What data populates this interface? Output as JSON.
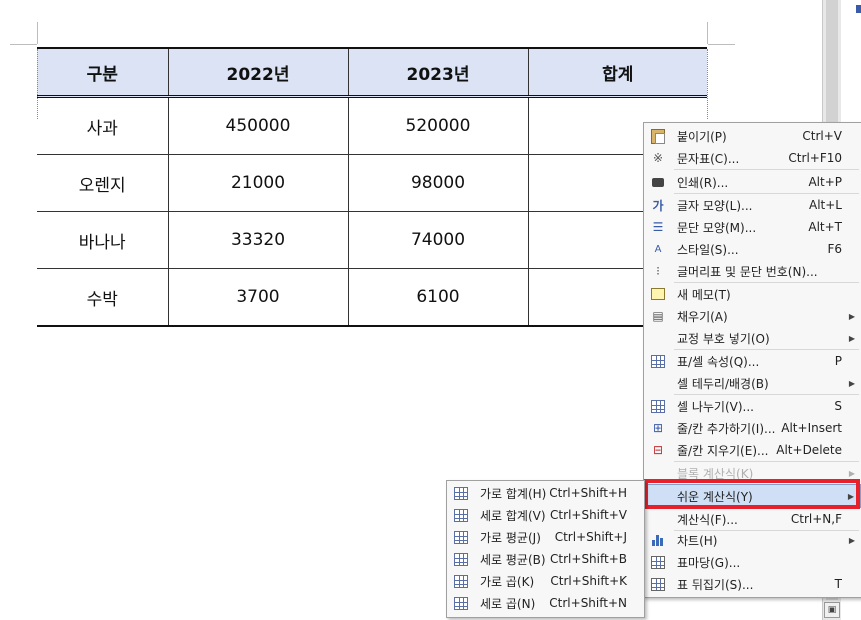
{
  "table": {
    "headers": [
      "구분",
      "2022년",
      "2023년",
      "합계"
    ],
    "rows": [
      [
        "사과",
        "450000",
        "520000",
        ""
      ],
      [
        "오렌지",
        "21000",
        "98000",
        ""
      ],
      [
        "바나나",
        "33320",
        "74000",
        ""
      ],
      [
        "수박",
        "3700",
        "6100",
        ""
      ]
    ]
  },
  "context_menu": {
    "items": [
      {
        "label": "붙이기(P)",
        "shortcut": "Ctrl+V",
        "icon": "paste-icon"
      },
      {
        "label": "문자표(C)...",
        "shortcut": "Ctrl+F10",
        "icon": "symbol-icon"
      },
      {
        "label": "인쇄(R)...",
        "shortcut": "Alt+P",
        "icon": "print-icon"
      },
      {
        "label": "글자 모양(L)...",
        "shortcut": "Alt+L",
        "icon": "font-shape-icon"
      },
      {
        "label": "문단 모양(M)...",
        "shortcut": "Alt+T",
        "icon": "paragraph-shape-icon"
      },
      {
        "label": "스타일(S)...",
        "shortcut": "F6",
        "icon": "style-icon"
      },
      {
        "label": "글머리표 및 문단 번호(N)...",
        "shortcut": "",
        "icon": "bullet-icon"
      },
      {
        "label": "새 메모(T)",
        "shortcut": "",
        "icon": "memo-icon"
      },
      {
        "label": "채우기(A)",
        "shortcut": "",
        "icon": "fill-icon",
        "submenu": true
      },
      {
        "label": "교정 부호 넣기(O)",
        "shortcut": "",
        "icon": "",
        "submenu": true
      },
      {
        "label": "표/셀 속성(Q)...",
        "shortcut": "P",
        "icon": "table-props-icon"
      },
      {
        "label": "셀 테두리/배경(B)",
        "shortcut": "",
        "icon": "",
        "submenu": true
      },
      {
        "label": "셀 나누기(V)...",
        "shortcut": "S",
        "icon": "split-cell-icon"
      },
      {
        "label": "줄/칸 추가하기(I)...",
        "shortcut": "Alt+Insert",
        "icon": "insert-row-icon"
      },
      {
        "label": "줄/칸 지우기(E)...",
        "shortcut": "Alt+Delete",
        "icon": "delete-row-icon"
      },
      {
        "label": "블록 계산식(K)",
        "shortcut": "",
        "icon": "",
        "submenu": true,
        "disabled": true
      },
      {
        "label": "쉬운 계산식(Y)",
        "shortcut": "",
        "icon": "",
        "submenu": true,
        "highlighted": true
      },
      {
        "label": "계산식(F)...",
        "shortcut": "Ctrl+N,F",
        "icon": ""
      },
      {
        "label": "차트(H)",
        "shortcut": "",
        "icon": "chart-icon",
        "submenu": true
      },
      {
        "label": "표마당(G)...",
        "shortcut": "",
        "icon": "table-template-icon"
      },
      {
        "label": "표 뒤집기(S)...",
        "shortcut": "T",
        "icon": "table-flip-icon"
      }
    ]
  },
  "sub_menu": {
    "items": [
      {
        "label": "가로 합계(H)",
        "shortcut": "Ctrl+Shift+H",
        "icon": "row-sum-icon"
      },
      {
        "label": "세로 합계(V)",
        "shortcut": "Ctrl+Shift+V",
        "icon": "col-sum-icon"
      },
      {
        "label": "가로 평균(J)",
        "shortcut": "Ctrl+Shift+J",
        "icon": "row-avg-icon"
      },
      {
        "label": "세로 평균(B)",
        "shortcut": "Ctrl+Shift+B",
        "icon": "col-avg-icon"
      },
      {
        "label": "가로 곱(K)",
        "shortcut": "Ctrl+Shift+K",
        "icon": "row-product-icon"
      },
      {
        "label": "세로 곱(N)",
        "shortcut": "Ctrl+Shift+N",
        "icon": "col-product-icon"
      }
    ]
  },
  "colors": {
    "header_fill": "#dbe3f5",
    "highlight": "#cfe0f6",
    "focus_frame": "#e8202c"
  }
}
